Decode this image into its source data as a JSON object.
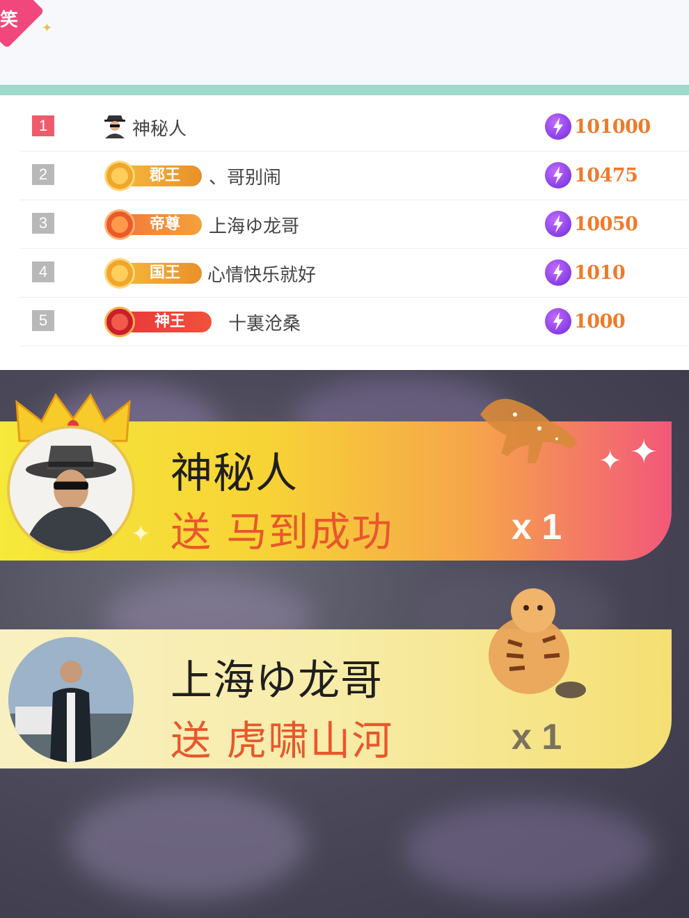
{
  "header": {
    "corner_badge": "笑"
  },
  "colors": {
    "accent_mint": "#9fd9cb",
    "rank_one": "#ee5b6a",
    "score_orange": "#ef7a2a"
  },
  "ranking": [
    {
      "rank": "1",
      "name": "神秘人",
      "badge": null,
      "score": "101000",
      "icon": "spy-icon"
    },
    {
      "rank": "2",
      "name": "、哥别闹",
      "badge": {
        "label": "郡王",
        "style": "gold"
      },
      "score": "10475"
    },
    {
      "rank": "3",
      "name": "上海ゆ龙哥",
      "badge": {
        "label": "帝尊",
        "style": "orange"
      },
      "score": "10050"
    },
    {
      "rank": "4",
      "name": "心情快乐就好",
      "badge": {
        "label": "国王",
        "style": "gold"
      },
      "score": "1010"
    },
    {
      "rank": "5",
      "name": "十裏沧桑",
      "badge": {
        "label": "神王",
        "style": "red"
      },
      "score": "1000"
    }
  ],
  "gift_banners": [
    {
      "sender": "神秘人",
      "gift_text": "送 马到成功",
      "count": "x 1",
      "gift_icon": "horse-icon"
    },
    {
      "sender": "上海ゆ龙哥",
      "gift_text": "送 虎啸山河",
      "count": "x 1",
      "gift_icon": "tiger-icon"
    }
  ]
}
